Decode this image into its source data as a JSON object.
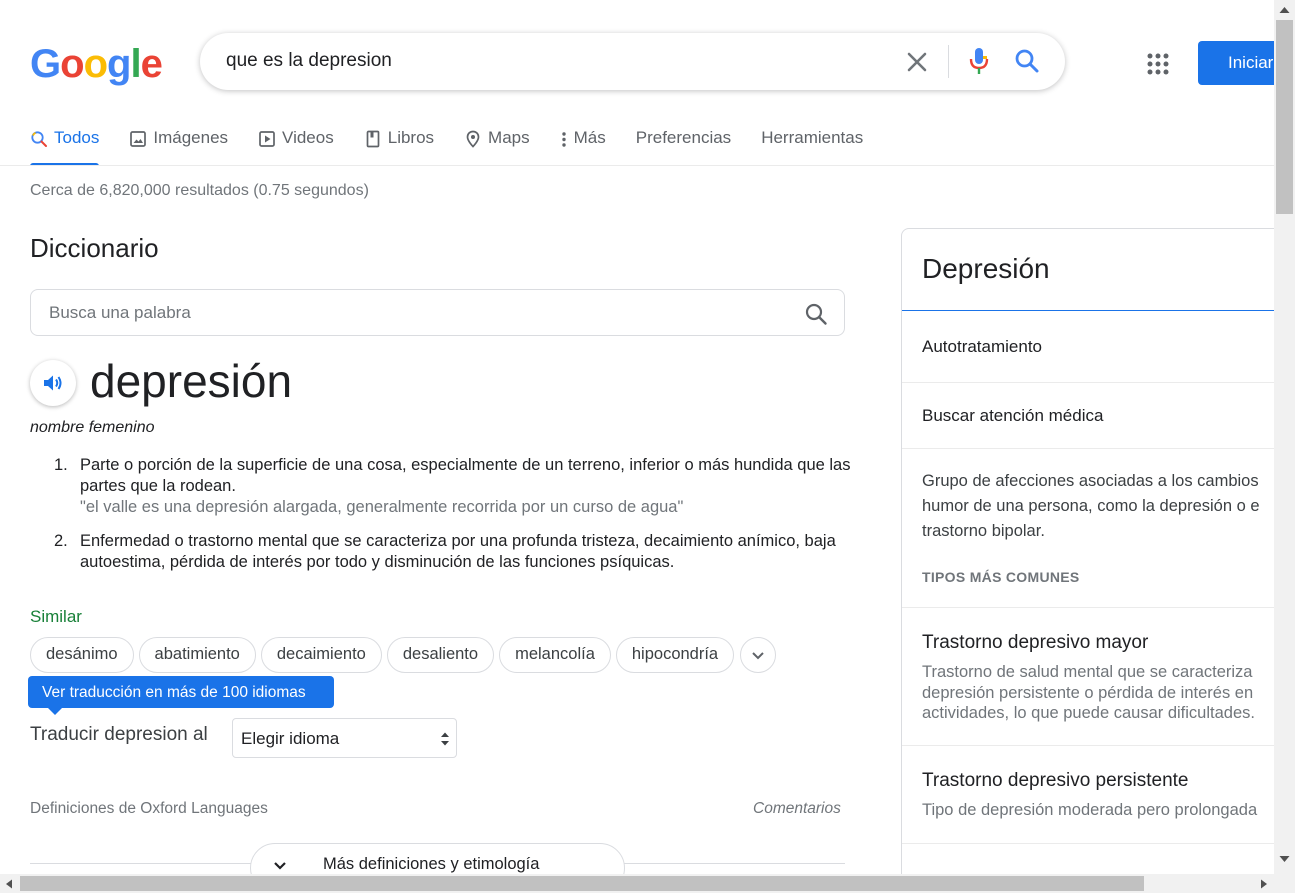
{
  "logo": {
    "letters": [
      "G",
      "o",
      "o",
      "g",
      "l",
      "e"
    ],
    "colors": [
      "#4285f4",
      "#ea4335",
      "#fbbc05",
      "#4285f4",
      "#34a853",
      "#ea4335"
    ]
  },
  "search": {
    "query": "que es la depresion"
  },
  "header": {
    "signin_label": "Iniciar"
  },
  "tabs": [
    {
      "label": "Todos",
      "icon": "search-icon",
      "active": true
    },
    {
      "label": "Imágenes",
      "icon": "image-icon"
    },
    {
      "label": "Videos",
      "icon": "video-icon"
    },
    {
      "label": "Libros",
      "icon": "book-icon"
    },
    {
      "label": "Maps",
      "icon": "map-pin-icon"
    },
    {
      "label": "Más",
      "icon": "more-vert-icon"
    },
    {
      "label": "Preferencias"
    },
    {
      "label": "Herramientas"
    }
  ],
  "stats": "Cerca de 6,820,000 resultados (0.75 segundos)",
  "dictionary": {
    "title": "Diccionario",
    "search_placeholder": "Busca una palabra",
    "word": "depresión",
    "part_of_speech": "nombre femenino",
    "definitions": [
      {
        "num": "1.",
        "text": "Parte o porción de la superficie de una cosa, especialmente de un terreno, inferior o más hundida que las partes que la rodean.",
        "example": "\"el valle es una depresión alargada, generalmente recorrida por un curso de agua\""
      },
      {
        "num": "2.",
        "text": "Enfermedad o trastorno mental que se caracteriza por una profunda tristeza, decaimiento anímico, baja autoestima, pérdida de interés por todo y disminución de las funciones psíquicas."
      }
    ],
    "similar_label": "Similar",
    "similar": [
      "desánimo",
      "abatimiento",
      "decaimiento",
      "desaliento",
      "melancolía",
      "hipocondría"
    ],
    "translate_tooltip": "Ver traducción en más de 100 idiomas",
    "translate_label": "Traducir depresion al",
    "language_select": "Elegir idioma",
    "source": "Definiciones de Oxford Languages",
    "comments": "Comentarios",
    "more_button": "Más definiciones y etimología"
  },
  "knowledge_panel": {
    "title": "Depresión",
    "links": [
      "Autotratamiento",
      "Buscar atención médica"
    ],
    "description": [
      "Grupo de afecciones asociadas a los cambios",
      "humor de una persona, como la depresión o e",
      "trastorno bipolar."
    ],
    "types_heading": "TIPOS MÁS COMUNES",
    "types": [
      {
        "title": "Trastorno depresivo mayor",
        "desc": [
          "Trastorno de salud mental que se caracteriza",
          "depresión persistente o pérdida de interés en",
          "actividades, lo que puede causar dificultades."
        ]
      },
      {
        "title": "Trastorno depresivo persistente",
        "desc": [
          "Tipo de depresión moderada pero prolongada"
        ]
      }
    ]
  }
}
